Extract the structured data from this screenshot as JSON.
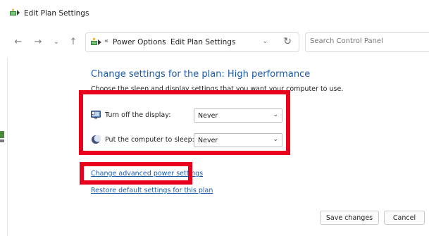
{
  "window": {
    "title": "Edit Plan Settings"
  },
  "nav": {
    "back_glyph": "←",
    "forward_glyph": "→",
    "recent_glyph": "⌄",
    "up_glyph": "↑"
  },
  "address": {
    "chevron": "«",
    "crumbs": [
      "Power Options",
      "Edit Plan Settings"
    ],
    "separator": "›",
    "dropdown_glyph": "⌄",
    "refresh_glyph": "↻"
  },
  "search": {
    "placeholder": "Search Control Panel"
  },
  "main": {
    "heading": "Change settings for the plan: High performance",
    "subtext": "Choose the sleep and display settings that you want your computer to use.",
    "settings": [
      {
        "label": "Turn off the display:",
        "value": "Never",
        "icon": "monitor-icon"
      },
      {
        "label": "Put the computer to sleep:",
        "value": "Never",
        "icon": "moon-icon"
      }
    ],
    "select_arrow": "⌄",
    "links": {
      "advanced": "Change advanced power settings",
      "restore": "Restore default settings for this plan"
    }
  },
  "footer": {
    "save_label": "Save changes",
    "cancel_label": "Cancel"
  },
  "colors": {
    "accent_link": "#1e5aa8",
    "highlight": "#e8001c"
  }
}
